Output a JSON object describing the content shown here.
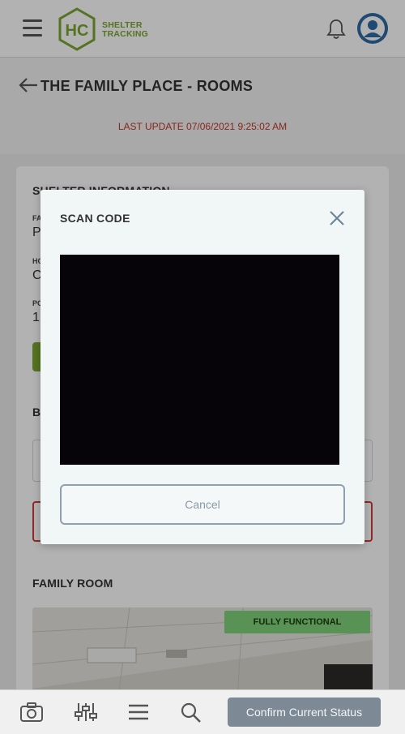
{
  "header": {
    "logo_letters": "HC",
    "logo_line1": "SHELTER",
    "logo_line2": "TRACKING",
    "brand_color": "#7aa530"
  },
  "page": {
    "title": "THE FAMILY PLACE - ROOMS",
    "last_update": "LAST UPDATE 07/06/2021 9:25:02 AM"
  },
  "background_card": {
    "section_title": "SHELTER INFORMATION",
    "fields": [
      {
        "label": "FA",
        "value": "P"
      },
      {
        "label": "HO",
        "value": "C"
      },
      {
        "label": "PO",
        "value": "1"
      }
    ],
    "section2_initial": "B",
    "room_title": "FAMILY ROOM",
    "room_status": "FULLY FUNCTIONAL"
  },
  "modal": {
    "title": "SCAN CODE",
    "cancel_label": "Cancel"
  },
  "bottom_bar": {
    "confirm_label": "Confirm Current Status",
    "icons": [
      "camera-icon",
      "sliders-icon",
      "list-icon",
      "search-icon"
    ]
  }
}
